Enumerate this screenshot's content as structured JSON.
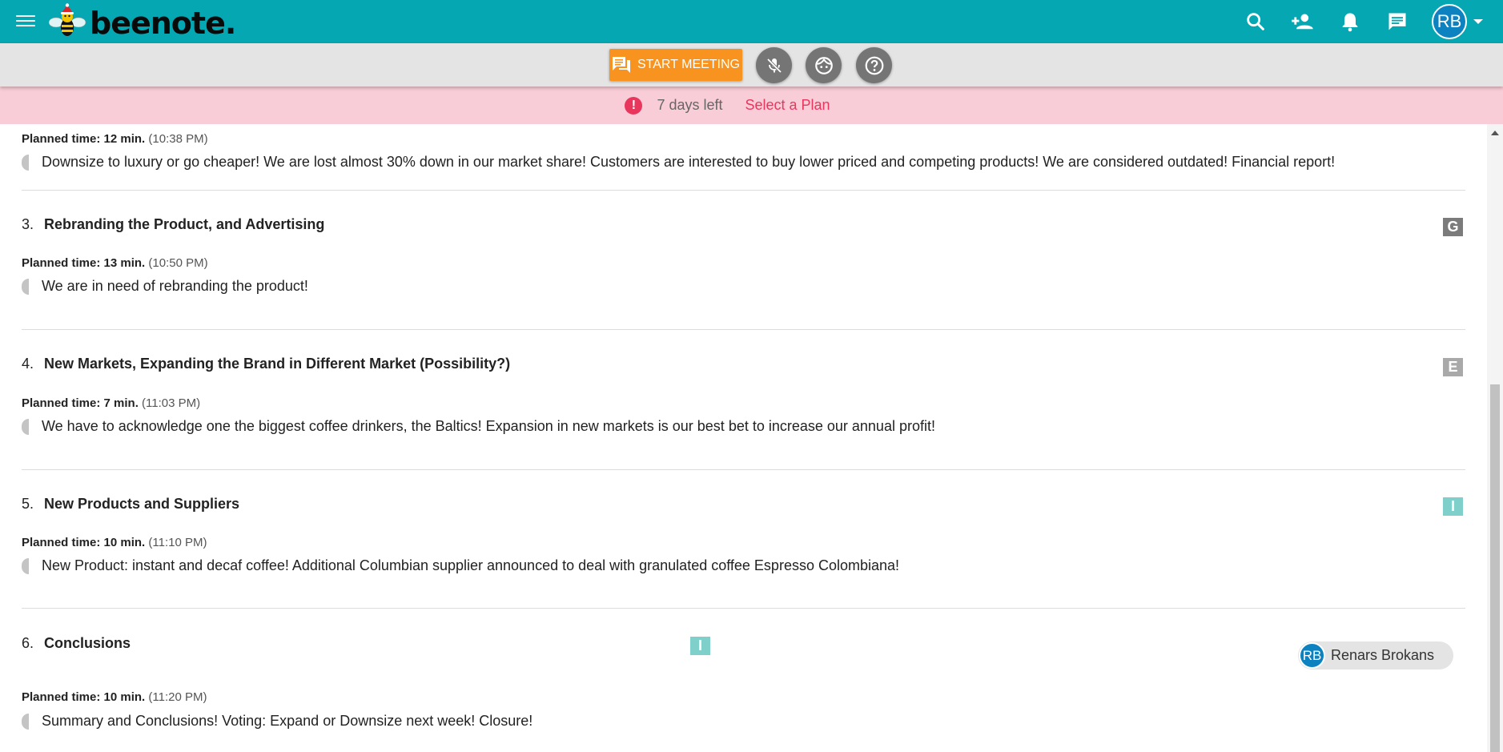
{
  "app": {
    "logo_text": "beenote.",
    "avatar_initials": "RB"
  },
  "toolbar": {
    "start_meeting_label": "START MEETING"
  },
  "banner": {
    "alert_symbol": "!",
    "days_left": "7 days left",
    "select_plan": "Select a Plan"
  },
  "agenda": {
    "item2": {
      "planned_label": "Planned time: 12 min.",
      "planned_time": "(10:38 PM)",
      "description": "Downsize to luxury or go cheaper! We are lost almost 30% down in our market share! Customers are interested to buy lower priced and competing products! We are considered outdated! Financial report!"
    },
    "item3": {
      "number": "3.",
      "title": "Rebranding the Product, and Advertising",
      "planned_label": "Planned time: 13 min.",
      "planned_time": "(10:50 PM)",
      "description": "We are in need of rebranding the product!",
      "tag": "G",
      "tag_color": "#7b7b7b"
    },
    "item4": {
      "number": "4.",
      "title": "New Markets, Expanding the Brand in Different Market (Possibility?)",
      "planned_label": "Planned time: 7 min.",
      "planned_time": "(11:03 PM)",
      "description": "We have to acknowledge one the biggest coffee drinkers, the Baltics! Expansion in new markets is our best bet to increase our annual profit!",
      "tag": "E",
      "tag_color": "#a9a9a9"
    },
    "item5": {
      "number": "5.",
      "title": "New Products and Suppliers",
      "planned_label": "Planned time: 10 min.",
      "planned_time": "(11:10 PM)",
      "description": "New Product: instant and decaf coffee! Additional Columbian supplier announced to deal with granulated coffee Espresso Colombiana!",
      "tag": "I",
      "tag_color": "#7fcfcb"
    },
    "item6": {
      "number": "6.",
      "title": "Conclusions",
      "planned_label": "Planned time: 10 min.",
      "planned_time": "(11:20 PM)",
      "description": "Summary and Conclusions! Voting: Expand or Downsize next week! Closure!",
      "tag": "I",
      "tag_color": "#7fcfcb",
      "assignee_initials": "RB",
      "assignee_name": "Renars Brokans"
    }
  },
  "colors": {
    "topbar": "#04a7b2",
    "start_button": "#f7931e",
    "banner_bg": "#f9cdd7",
    "alert": "#e8365d",
    "avatar": "#0c82c1"
  },
  "icons": [
    "menu-icon",
    "bee-logo",
    "search-icon",
    "add-person-icon",
    "bell-icon",
    "chat-icon",
    "chevron-down-icon",
    "meeting-icon",
    "mic-off-icon",
    "face-icon",
    "help-icon",
    "alert-icon"
  ]
}
